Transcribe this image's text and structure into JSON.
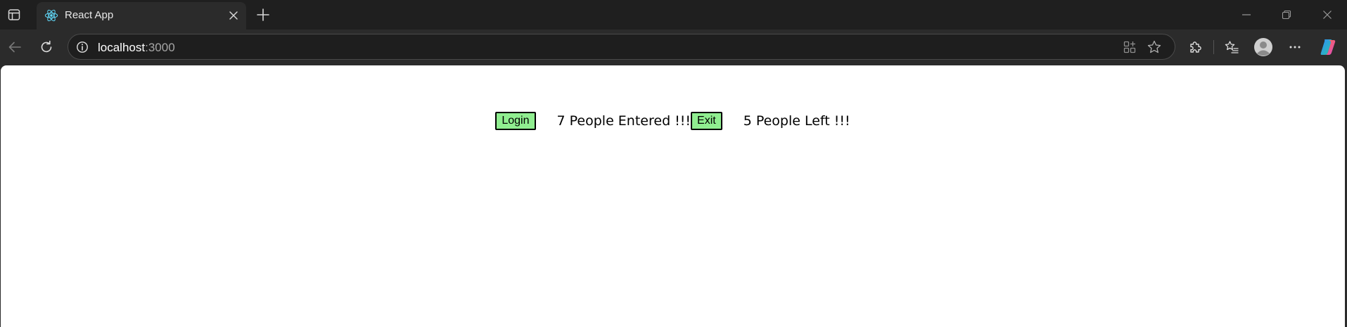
{
  "browser": {
    "tab": {
      "title": "React App",
      "favicon": "react-logo-icon"
    },
    "address_bar": {
      "host": "localhost",
      "port": ":3000"
    },
    "colors": {
      "chrome_dark": "#1f1f1f",
      "toolbar": "#2b2b2b",
      "omnibox": "#1e1e1e",
      "react_blue": "#61dafb"
    }
  },
  "page": {
    "background": "#ffffff",
    "entry": {
      "button_label": "Login",
      "count": 7,
      "message": "7 People Entered !!!"
    },
    "exit": {
      "button_label": "Exit",
      "count": 5,
      "message": "5 People Left !!!"
    },
    "button_color": "#90ee90"
  }
}
